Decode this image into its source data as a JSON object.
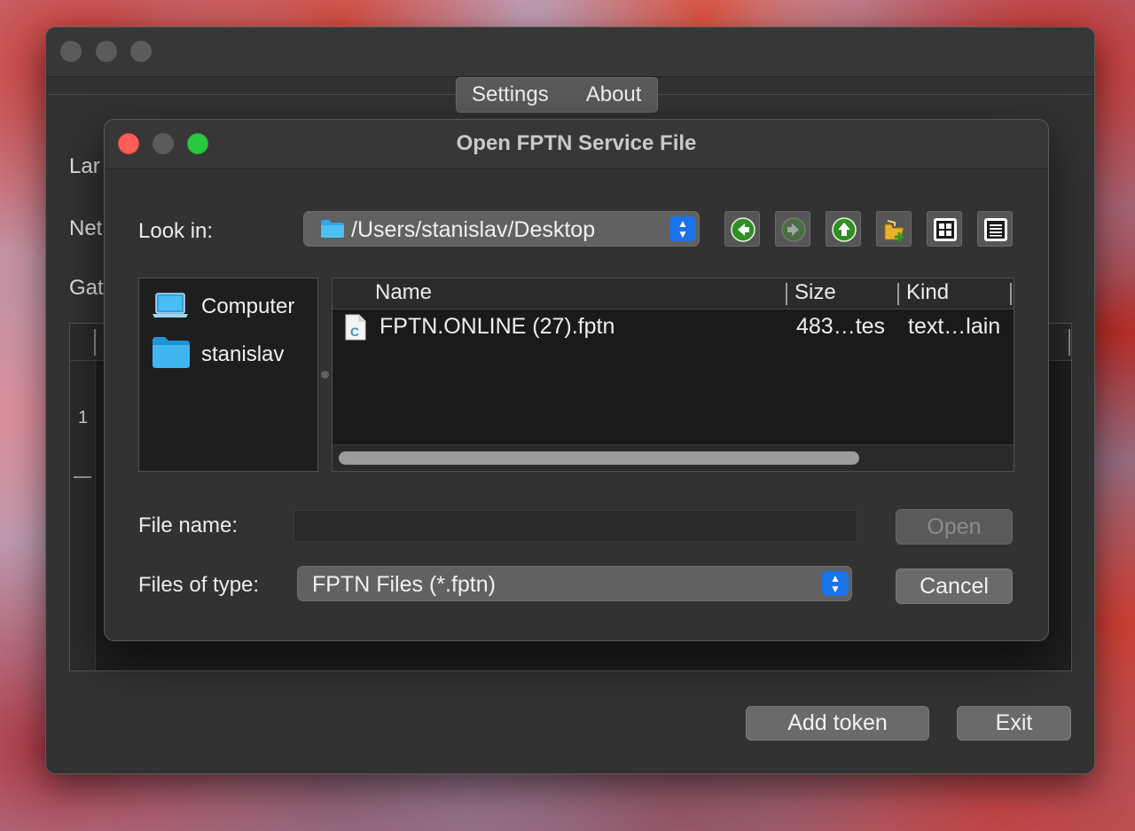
{
  "main_window": {
    "tabs": [
      {
        "label": "Settings"
      },
      {
        "label": "About"
      }
    ],
    "labels": {
      "language": "Lar",
      "network": "Net",
      "gateway": "Gat"
    },
    "table": {
      "row_number": "1"
    },
    "buttons": {
      "add_token": "Add token",
      "exit": "Exit"
    }
  },
  "dialog": {
    "title": "Open FPTN Service File",
    "look_in_label": "Look in:",
    "path": "/Users/stanislav/Desktop",
    "toolbar": {
      "back_icon": "back-arrow-icon",
      "forward_icon": "forward-arrow-icon",
      "up_icon": "parent-directory-icon",
      "new_folder_icon": "new-folder-icon",
      "detail_icon": "detail-view-icon",
      "list_icon": "list-view-icon"
    },
    "sidebar": [
      {
        "label": "Computer",
        "icon": "computer-icon"
      },
      {
        "label": "stanislav",
        "icon": "folder-icon"
      }
    ],
    "columns": {
      "name": "Name",
      "size": "Size",
      "kind": "Kind"
    },
    "files": [
      {
        "name": "FPTN.ONLINE (27).fptn",
        "size": "483…tes",
        "kind": "text…lain",
        "icon": "text-file-icon"
      }
    ],
    "file_name_label": "File name:",
    "file_name_value": "",
    "files_of_type_label": "Files of type:",
    "files_of_type_value": "FPTN Files (*.fptn)",
    "buttons": {
      "open": "Open",
      "cancel": "Cancel"
    }
  },
  "colors": {
    "accent_blue": "#1a73e8",
    "close_red": "#ff5f57",
    "zoom_green": "#28c840",
    "window_bg": "#323232"
  }
}
